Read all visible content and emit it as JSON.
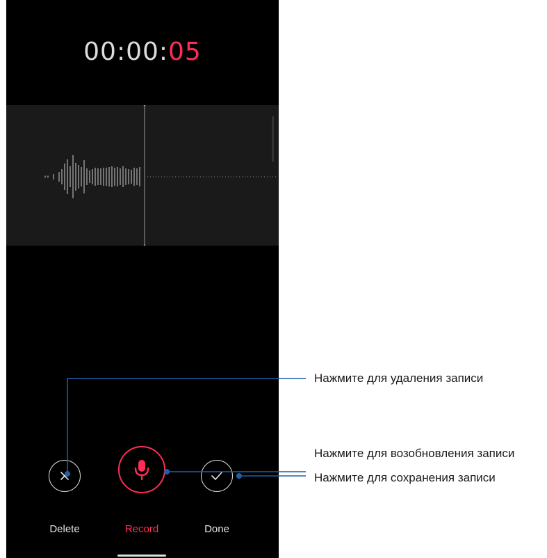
{
  "recorder": {
    "timer_prefix": "00:00:",
    "timer_seconds": "05",
    "controls": {
      "delete_label": "Delete",
      "record_label": "Record",
      "done_label": "Done"
    }
  },
  "annotations": {
    "delete_hint": "Нажмите для удаления записи",
    "record_hint": "Нажмите для возобновления записи",
    "done_hint": "Нажмите для сохранения записи"
  },
  "icons": {
    "delete": "close-icon",
    "record": "microphone-icon",
    "done": "checkmark-icon"
  },
  "colors": {
    "accent": "#ff2d55",
    "callout": "#1f5fa8",
    "background": "#000000",
    "waveform_panel": "#1a1a1a"
  }
}
